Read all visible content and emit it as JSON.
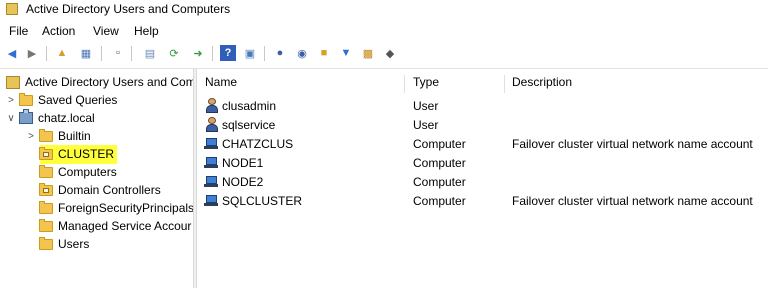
{
  "window": {
    "title": "Active Directory Users and Computers"
  },
  "menu": {
    "items": [
      "File",
      "Action",
      "View",
      "Help"
    ]
  },
  "toolbar": {
    "buttons": [
      "back-icon",
      "forward-icon",
      "up-folder-icon",
      "show-hide-tree-icon",
      "copy-icon",
      "export-list-icon",
      "refresh-icon",
      "export-icon",
      "help-icon",
      "properties-icon",
      "new-user-icon",
      "new-group-icon",
      "new-ou-icon",
      "filter-icon",
      "find-icon",
      "delegate-icon"
    ]
  },
  "tree": {
    "root": "Active Directory Users and Com",
    "items": [
      {
        "label": "Saved Queries",
        "indent": 1,
        "expander": ">",
        "icon": "folder"
      },
      {
        "label": "chatz.local",
        "indent": 1,
        "expander": "v",
        "icon": "domain"
      },
      {
        "label": "Builtin",
        "indent": 2,
        "expander": ">",
        "icon": "folder"
      },
      {
        "label": "CLUSTER",
        "indent": 2,
        "expander": "",
        "icon": "ou-folder",
        "selected": true
      },
      {
        "label": "Computers",
        "indent": 2,
        "expander": "",
        "icon": "folder"
      },
      {
        "label": "Domain Controllers",
        "indent": 2,
        "expander": "",
        "icon": "ou-folder"
      },
      {
        "label": "ForeignSecurityPrincipals",
        "indent": 2,
        "expander": "",
        "icon": "folder"
      },
      {
        "label": "Managed Service Accour",
        "indent": 2,
        "expander": "",
        "icon": "folder"
      },
      {
        "label": "Users",
        "indent": 2,
        "expander": "",
        "icon": "folder"
      }
    ]
  },
  "list": {
    "columns": [
      "Name",
      "Type",
      "Description"
    ],
    "rows": [
      {
        "name": "clusadmin",
        "type": "User",
        "description": "",
        "icon": "user"
      },
      {
        "name": "sqlservice",
        "type": "User",
        "description": "",
        "icon": "user"
      },
      {
        "name": "CHATZCLUS",
        "type": "Computer",
        "description": "Failover cluster virtual network name account",
        "icon": "computer"
      },
      {
        "name": "NODE1",
        "type": "Computer",
        "description": "",
        "icon": "computer"
      },
      {
        "name": "NODE2",
        "type": "Computer",
        "description": "",
        "icon": "computer"
      },
      {
        "name": "SQLCLUSTER",
        "type": "Computer",
        "description": "Failover cluster virtual network name account",
        "icon": "computer"
      }
    ]
  },
  "colors": {
    "selection_highlight": "#ffff3c",
    "folder": "#f3c54e"
  }
}
